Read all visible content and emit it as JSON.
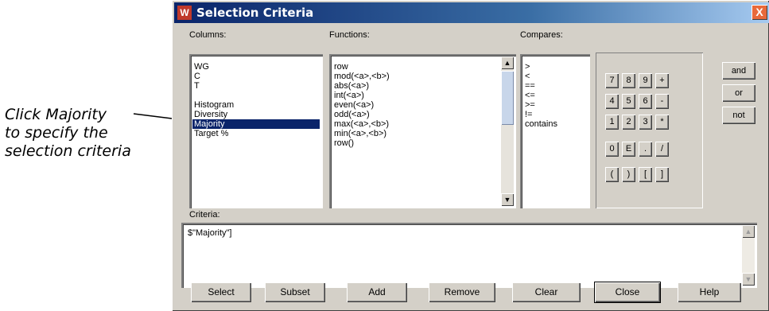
{
  "callout": {
    "lines": [
      "Click Majority",
      "to specify the",
      "selection criteria"
    ]
  },
  "dialog": {
    "title": "Selection Criteria",
    "close_glyph": "X",
    "app_icon": "app-icon"
  },
  "columns": {
    "label": "Columns:",
    "items": [
      "WG",
      "C",
      "T",
      "Histogram",
      "Diversity",
      "Majority",
      "Target %"
    ],
    "selected": "Majority"
  },
  "functions": {
    "label": "Functions:",
    "items": [
      "row",
      "mod(<a>,<b>)",
      "abs(<a>)",
      "int(<a>)",
      "even(<a>)",
      "odd(<a>)",
      "max(<a>,<b>)",
      "min(<a>,<b>)",
      "row()"
    ]
  },
  "compares": {
    "label": "Compares:",
    "items": [
      ">",
      "<",
      "==",
      "<=",
      ">=",
      "!=",
      "contains"
    ]
  },
  "keypad": {
    "keys": [
      "7",
      "8",
      "9",
      "+",
      "4",
      "5",
      "6",
      "-",
      "1",
      "2",
      "3",
      "*",
      "0",
      "E",
      ".",
      "/",
      "(",
      ")",
      "[",
      "]"
    ]
  },
  "logic": {
    "and": "and",
    "or": "or",
    "not": "not"
  },
  "criteria": {
    "label": "Criteria:",
    "value": "$\"Majority\"]"
  },
  "buttons": {
    "select": "Select",
    "subset": "Subset",
    "add": "Add",
    "remove": "Remove",
    "clear": "Clear",
    "close": "Close",
    "help": "Help"
  }
}
